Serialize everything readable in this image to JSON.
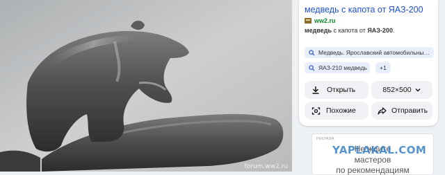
{
  "result": {
    "title": "медведь с капота от ЯАЗ-200",
    "site": "ww2.ru",
    "description_prefix": "медведь",
    "description_middle": " с капота от ",
    "description_suffix": "ЯАЗ-200",
    "description_end": "."
  },
  "tags": [
    {
      "label": "Медведь. Ярославский автомобильны…",
      "icon": "search-icon"
    },
    {
      "label": "ЯАЗ-210 медведь",
      "icon": "search-icon"
    },
    {
      "label": "+1"
    }
  ],
  "actions": {
    "open_label": "Открыть",
    "size_label": "852×500",
    "similar_label": "Похожие",
    "send_label": "Отправить"
  },
  "image": {
    "watermark": "forum.ww2.ru"
  },
  "ad": {
    "label": "РЕКЛАМА",
    "line1": "Не ждите",
    "line2": "мастеров",
    "line3": "по рекомендациям"
  },
  "overlay_brand": "YAPLAKAL.COM"
}
